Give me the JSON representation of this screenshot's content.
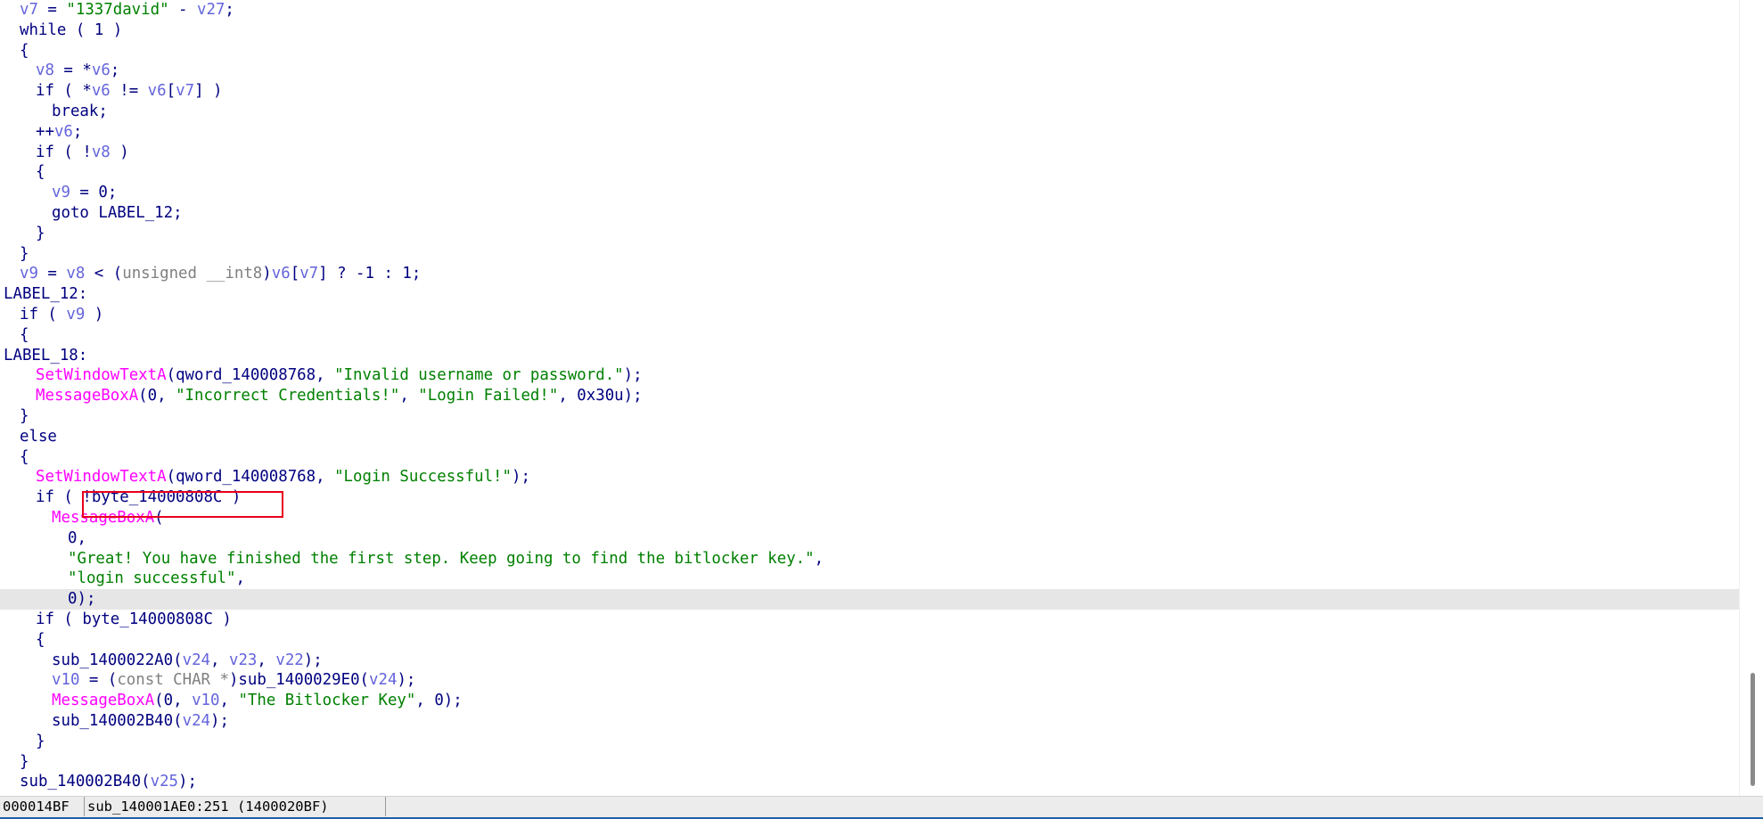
{
  "code_view": {
    "lines": [
      [
        [
          "v7",
          "v"
        ],
        [
          " = ",
          "k"
        ],
        [
          "\"1337david\"",
          "s"
        ],
        [
          " - ",
          "k"
        ],
        [
          "v27",
          "v"
        ],
        [
          ";",
          "k"
        ]
      ],
      [
        [
          "while ( 1 )",
          "k"
        ]
      ],
      [
        [
          "{",
          "k"
        ]
      ],
      [
        [
          "v8",
          "v"
        ],
        [
          " = *",
          "k"
        ],
        [
          "v6",
          "v"
        ],
        [
          ";",
          "k"
        ]
      ],
      [
        [
          "if ( *",
          "k"
        ],
        [
          "v6",
          "v"
        ],
        [
          " != ",
          "k"
        ],
        [
          "v6",
          "v"
        ],
        [
          "[",
          "k"
        ],
        [
          "v7",
          "v"
        ],
        [
          "] )",
          "k"
        ]
      ],
      [
        [
          "break;",
          "k"
        ]
      ],
      [
        [
          "++",
          "k"
        ],
        [
          "v6",
          "v"
        ],
        [
          ";",
          "k"
        ]
      ],
      [
        [
          "if ( !",
          "k"
        ],
        [
          "v8",
          "v"
        ],
        [
          " )",
          "k"
        ]
      ],
      [
        [
          "{",
          "k"
        ]
      ],
      [
        [
          "v9",
          "v"
        ],
        [
          " = 0;",
          "k"
        ]
      ],
      [
        [
          "goto LABEL_12;",
          "k"
        ]
      ],
      [
        [
          "}",
          "k"
        ]
      ],
      [
        [
          "}",
          "k"
        ]
      ],
      [
        [
          "v9",
          "v"
        ],
        [
          " = ",
          "k"
        ],
        [
          "v8",
          "v"
        ],
        [
          " < (",
          "k"
        ],
        [
          "unsigned __int8",
          "c"
        ],
        [
          ")",
          "k"
        ],
        [
          "v6",
          "v"
        ],
        [
          "[",
          "k"
        ],
        [
          "v7",
          "v"
        ],
        [
          "] ? -1 : 1;",
          "k"
        ]
      ],
      [
        [
          "LABEL_12:",
          "k"
        ]
      ],
      [
        [
          "if ( ",
          "k"
        ],
        [
          "v9",
          "v"
        ],
        [
          " )",
          "k"
        ]
      ],
      [
        [
          "{",
          "k"
        ]
      ],
      [
        [
          "LABEL_18:",
          "k"
        ]
      ],
      [
        [
          "SetWindowTextA",
          "f"
        ],
        [
          "(qword_140008768, ",
          "k"
        ],
        [
          "\"Invalid username or password.\"",
          "s"
        ],
        [
          ");",
          "k"
        ]
      ],
      [
        [
          "MessageBoxA",
          "f"
        ],
        [
          "(0, ",
          "k"
        ],
        [
          "\"Incorrect Credentials!\"",
          "s"
        ],
        [
          ", ",
          "k"
        ],
        [
          "\"Login Failed!\"",
          "s"
        ],
        [
          ", 0x30u);",
          "k"
        ]
      ],
      [
        [
          "}",
          "k"
        ]
      ],
      [
        [
          "else",
          "k"
        ]
      ],
      [
        [
          "{",
          "k"
        ]
      ],
      [
        [
          "SetWindowTextA",
          "f"
        ],
        [
          "(qword_140008768, ",
          "k"
        ],
        [
          "\"Login Successful!\"",
          "s"
        ],
        [
          ");",
          "k"
        ]
      ],
      [
        [
          "if ( !byte_14000808C )",
          "k"
        ]
      ],
      [
        [
          "MessageBoxA",
          "f"
        ],
        [
          "(",
          "k"
        ]
      ],
      [
        [
          "0,",
          "k"
        ]
      ],
      [
        [
          "\"Great! You have finished the first step. Keep going to find the bitlocker key.\"",
          "s"
        ],
        [
          ",",
          "k"
        ]
      ],
      [
        [
          "\"login successful\"",
          "s"
        ],
        [
          ",",
          "k"
        ]
      ],
      [
        [
          "0);",
          "k"
        ]
      ],
      [
        [
          "if ( byte_14000808C )",
          "k"
        ]
      ],
      [
        [
          "{",
          "k"
        ]
      ],
      [
        [
          "sub_1400022A0(",
          "k"
        ],
        [
          "v24",
          "v"
        ],
        [
          ", ",
          "k"
        ],
        [
          "v23",
          "v"
        ],
        [
          ", ",
          "k"
        ],
        [
          "v22",
          "v"
        ],
        [
          ");",
          "k"
        ]
      ],
      [
        [
          "v10",
          "v"
        ],
        [
          " = (",
          "k"
        ],
        [
          "const CHAR *",
          "c"
        ],
        [
          ")sub_1400029E0(",
          "k"
        ],
        [
          "v24",
          "v"
        ],
        [
          ");",
          "k"
        ]
      ],
      [
        [
          "MessageBoxA",
          "f"
        ],
        [
          "(0, ",
          "k"
        ],
        [
          "v10",
          "v"
        ],
        [
          ", ",
          "k"
        ],
        [
          "\"The Bitlocker Key\"",
          "s"
        ],
        [
          ", 0);",
          "k"
        ]
      ],
      [
        [
          "sub_140002B40(",
          "k"
        ],
        [
          "v24",
          "v"
        ],
        [
          ");",
          "k"
        ]
      ],
      [
        [
          "}",
          "k"
        ]
      ],
      [
        [
          "}",
          "k"
        ]
      ],
      [
        [
          "sub_140002B40(",
          "k"
        ],
        [
          "v25",
          "v"
        ],
        [
          ");",
          "k"
        ]
      ]
    ],
    "highlighted_line": 29
  },
  "status_bar": {
    "offset": "000014BF",
    "location": "sub_140001AE0:251 (1400020BF)"
  },
  "colors": {
    "keyword": "#000080",
    "variable": "#6464dc",
    "string": "#008000",
    "function": "#ff00ff",
    "type": "#808080",
    "selection_box": "#e8001c",
    "current_line": "#e6e6e6"
  }
}
